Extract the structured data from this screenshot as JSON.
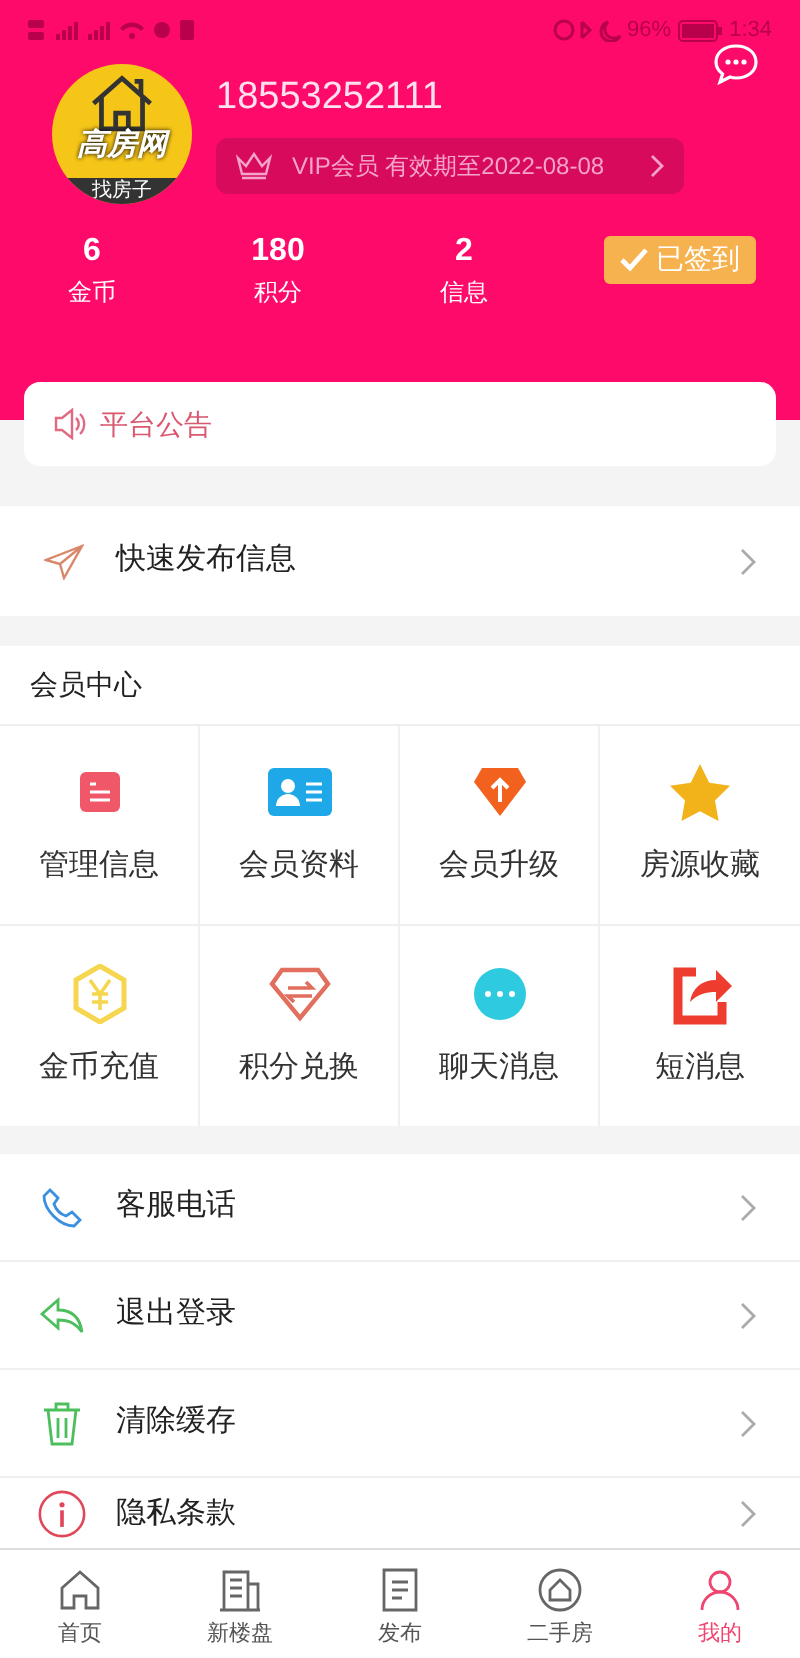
{
  "status_bar": {
    "battery": "96%",
    "time": "1:34"
  },
  "profile": {
    "logo_text": "高房网",
    "logo_subtext": "找房子",
    "phone": "18553252111",
    "vip": "VIP会员 有效期至2022-08-08"
  },
  "stats": [
    {
      "value": "6",
      "label": "金币"
    },
    {
      "value": "180",
      "label": "积分"
    },
    {
      "value": "2",
      "label": "信息"
    }
  ],
  "checkin": {
    "label": "已签到",
    "checked": true
  },
  "notice": {
    "label": "平台公告"
  },
  "quick_publish": {
    "label": "快速发布信息"
  },
  "member_center": {
    "title": "会员中心",
    "items": [
      {
        "label": "管理信息"
      },
      {
        "label": "会员资料"
      },
      {
        "label": "会员升级"
      },
      {
        "label": "房源收藏"
      },
      {
        "label": "金币充值"
      },
      {
        "label": "积分兑换"
      },
      {
        "label": "聊天消息"
      },
      {
        "label": "短消息"
      }
    ]
  },
  "menu": [
    {
      "label": "客服电话"
    },
    {
      "label": "退出登录"
    },
    {
      "label": "清除缓存"
    },
    {
      "label": "隐私条款"
    }
  ],
  "tabs": [
    {
      "label": "首页",
      "selected": false
    },
    {
      "label": "新楼盘",
      "selected": false
    },
    {
      "label": "发布",
      "selected": false
    },
    {
      "label": "二手房",
      "selected": false
    },
    {
      "label": "我的",
      "selected": true
    }
  ]
}
